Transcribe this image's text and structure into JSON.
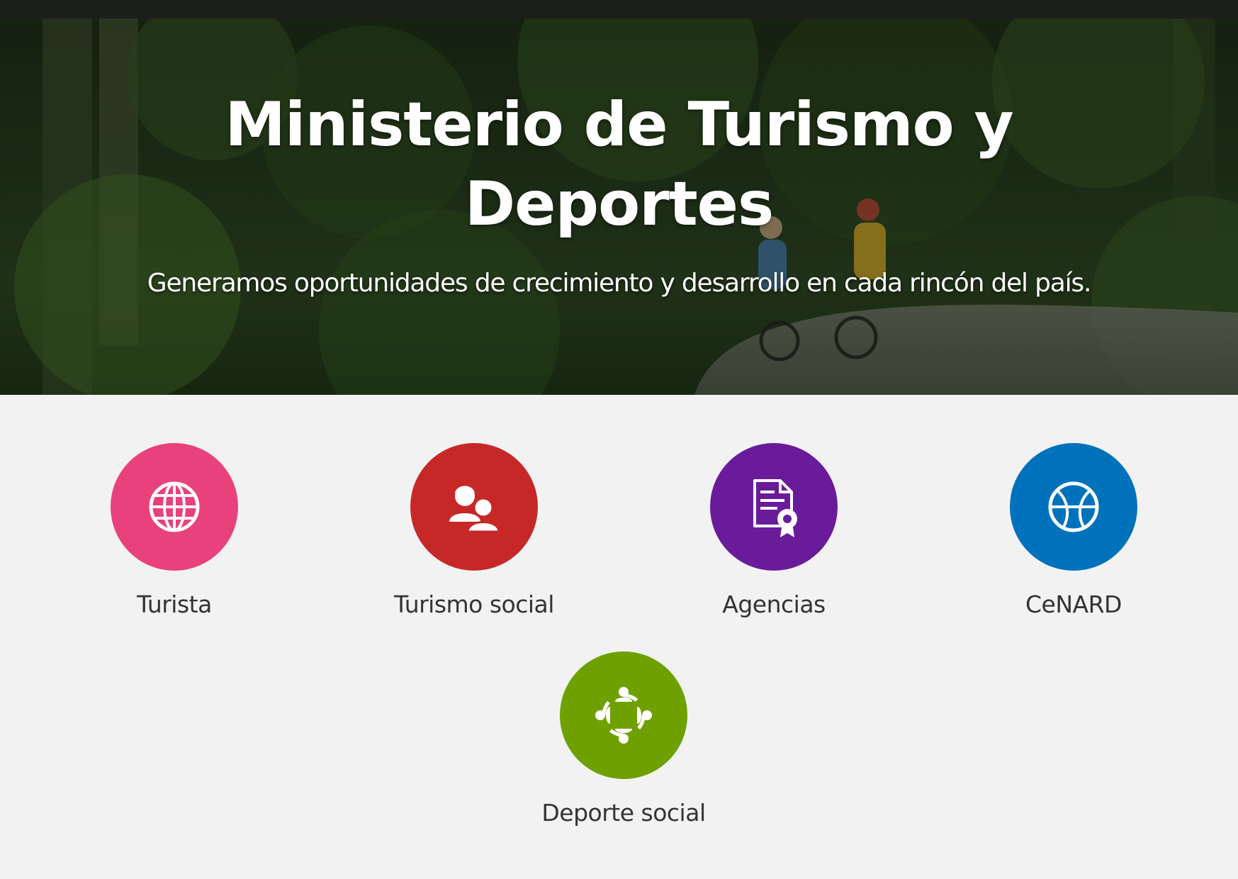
{
  "hero": {
    "title_line1": "Ministerio de Turismo y",
    "title_line2": "Deportes",
    "subtitle": "Generamos oportunidades de crecimiento y desarrollo en cada rincón del país."
  },
  "shortcuts": [
    {
      "label": "Turista",
      "icon": "globe-icon",
      "color": "#e8417c"
    },
    {
      "label": "Turismo social",
      "icon": "people-icon",
      "color": "#c62828"
    },
    {
      "label": "Agencias",
      "icon": "certificate-icon",
      "color": "#6a1b9a"
    },
    {
      "label": "CeNARD",
      "icon": "basketball-icon",
      "color": "#0072bb"
    },
    {
      "label": "Deporte social",
      "icon": "community-circle-icon",
      "color": "#6ea100"
    }
  ]
}
